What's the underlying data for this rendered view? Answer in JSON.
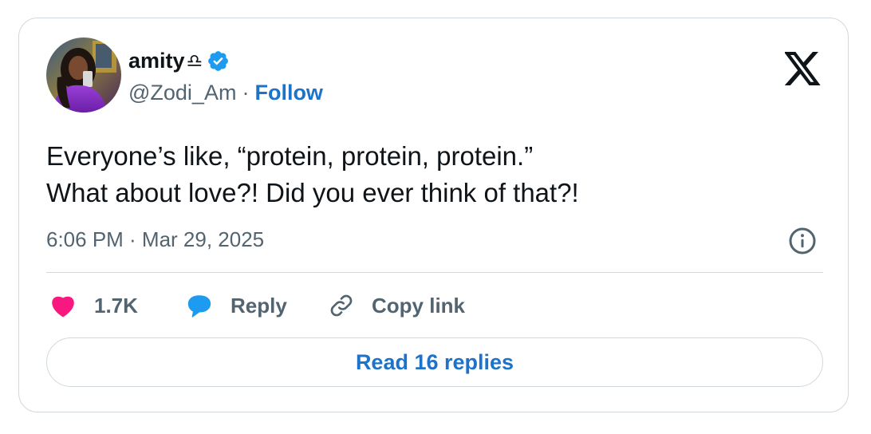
{
  "tweet": {
    "author": {
      "display_name": "amity",
      "name_emoji": "♎",
      "handle": "@Zodi_Am",
      "separator": "·",
      "follow_label": "Follow",
      "verified": true
    },
    "text_lines": [
      "Everyone’s like, “protein, protein, protein.”",
      "What about love?! Did you ever think of that?!"
    ],
    "timestamp": "6:06 PM · Mar 29, 2025",
    "actions": {
      "likes_count": "1.7K",
      "reply_label": "Reply",
      "copy_link_label": "Copy link"
    },
    "read_replies_label": "Read 16 replies"
  },
  "icons": {
    "verified_badge": "verified-badge-icon",
    "brand": "x-logo-icon",
    "info": "info-icon",
    "like": "heart-icon",
    "reply": "speech-bubble-icon",
    "copy": "link-icon"
  },
  "colors": {
    "link_blue": "#1d73c9",
    "verified_blue": "#1d9bf0",
    "heart_pink": "#f91880",
    "muted_gray": "#536471",
    "text_dark": "#0f1419",
    "border": "#cfd9de"
  }
}
